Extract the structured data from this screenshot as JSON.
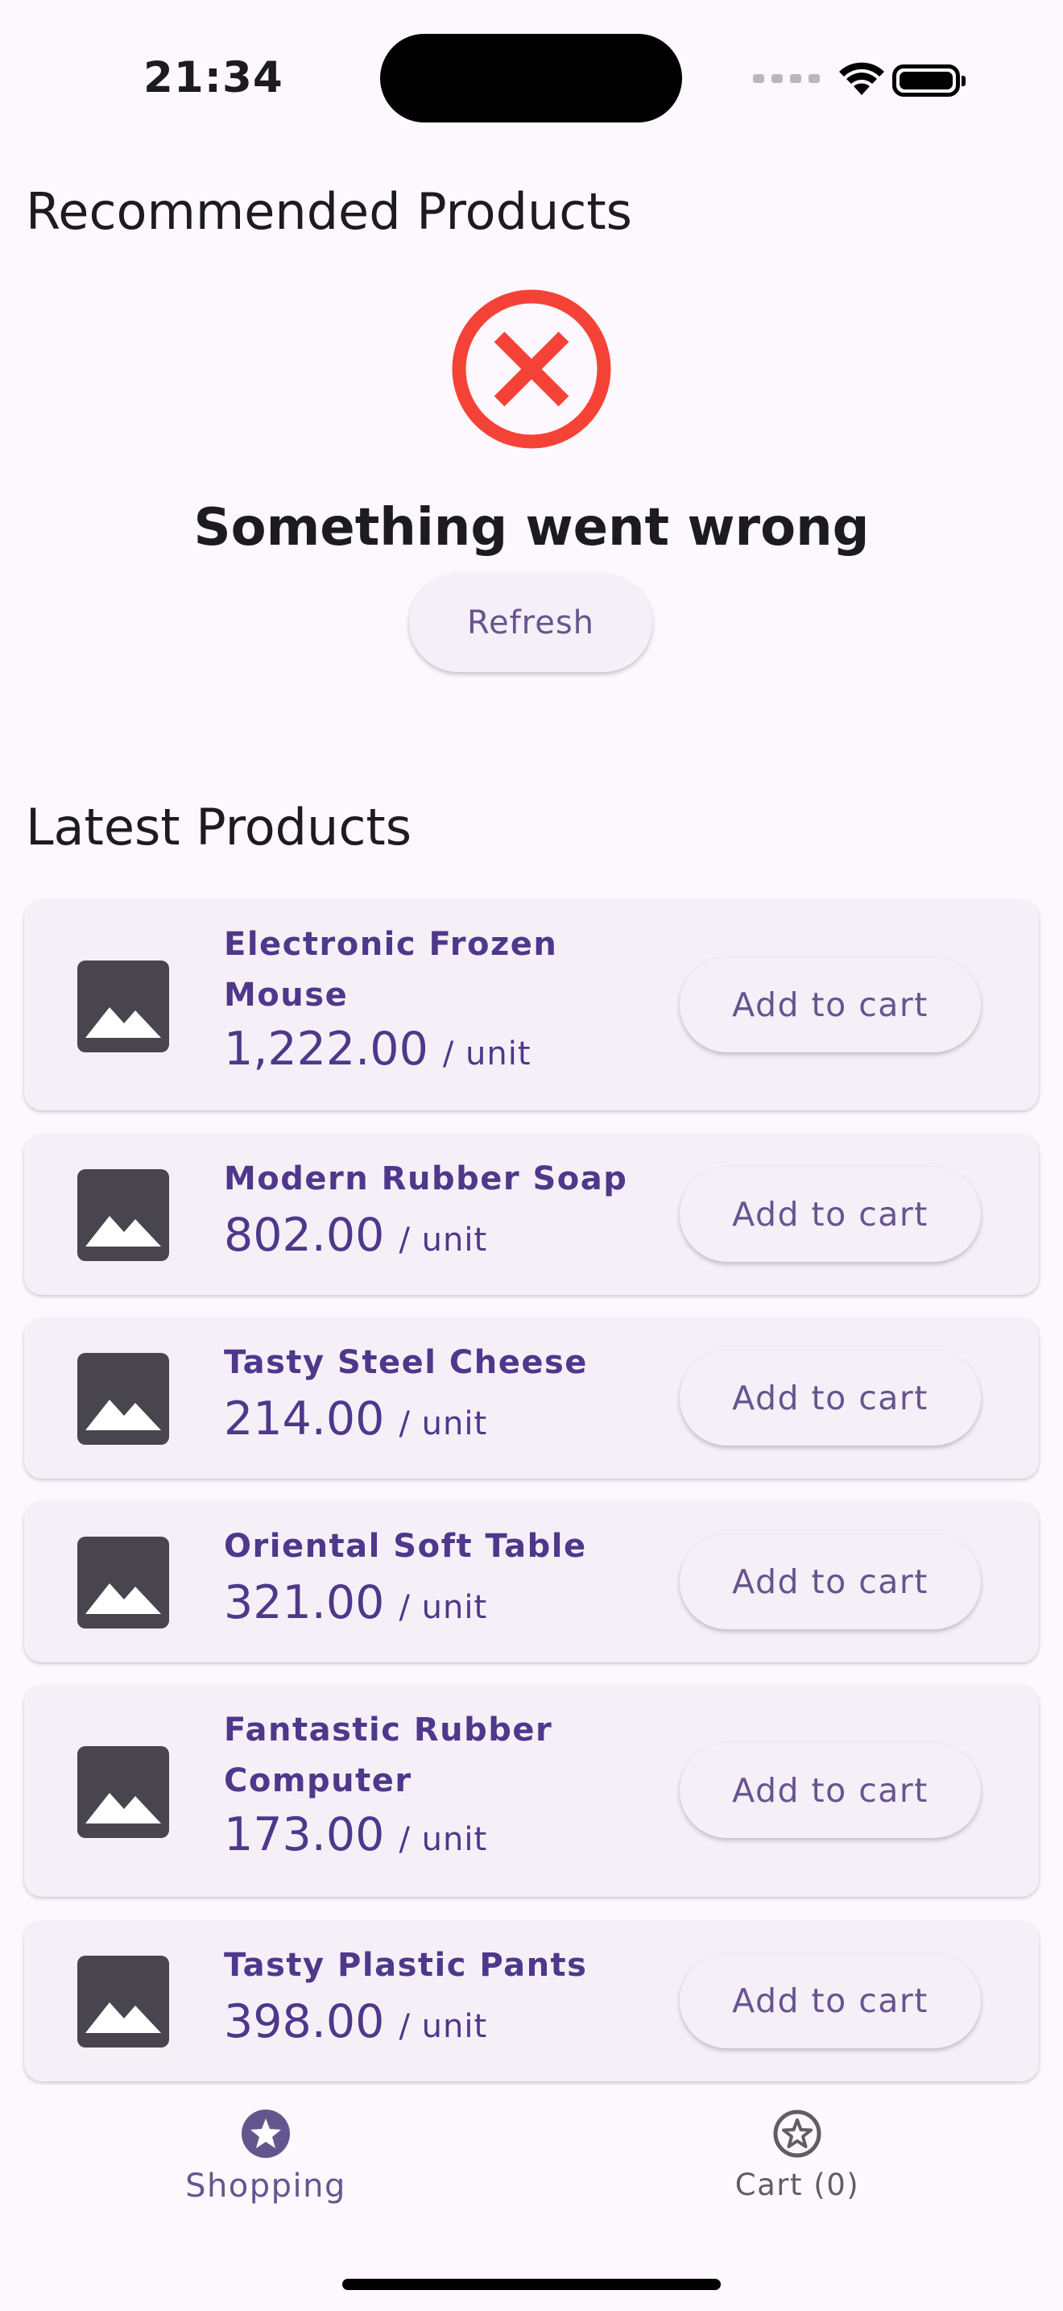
{
  "status_bar": {
    "time": "21:34"
  },
  "recommended": {
    "title": "Recommended Products",
    "error_message": "Something went wrong",
    "refresh_label": "Refresh"
  },
  "latest": {
    "title": "Latest Products",
    "unit_suffix": "/ unit",
    "add_label": "Add to cart",
    "products": [
      {
        "name": "Electronic Frozen Mouse",
        "price": "1,222.00"
      },
      {
        "name": "Modern Rubber Soap",
        "price": "802.00"
      },
      {
        "name": "Tasty Steel Cheese",
        "price": "214.00"
      },
      {
        "name": "Oriental Soft Table",
        "price": "321.00"
      },
      {
        "name": "Fantastic Rubber Computer",
        "price": "173.00"
      },
      {
        "name": "Tasty Plastic Pants",
        "price": "398.00"
      }
    ]
  },
  "bottom_nav": {
    "shopping_label": "Shopping",
    "cart_label": "Cart (0)"
  },
  "colors": {
    "background": "#fdf7fe",
    "accent": "#4f378b",
    "button_text": "#65558f",
    "error": "#f44336",
    "card": "#f5f0f7"
  },
  "icons": {
    "error": "error-circle-icon",
    "product_placeholder": "image-placeholder-icon",
    "shopping": "star-circle-icon",
    "cart": "star-circle-outline-icon",
    "wifi": "wifi-icon",
    "battery": "battery-icon"
  }
}
